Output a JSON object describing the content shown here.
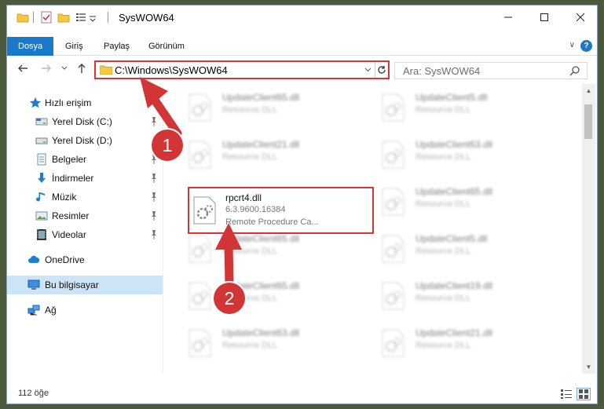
{
  "window": {
    "title": "SysWOW64"
  },
  "ribbon": {
    "tabs": [
      {
        "label": "Dosya",
        "active": true
      },
      {
        "label": "Giriş"
      },
      {
        "label": "Paylaş"
      },
      {
        "label": "Görünüm"
      }
    ],
    "help": "?"
  },
  "navbar": {
    "address": "C:\\Windows\\SysWOW64",
    "search_placeholder": "Ara: SysWOW64"
  },
  "sidebar": {
    "items": [
      {
        "label": "Hızlı erişim",
        "icon": "star-icon"
      },
      {
        "label": "Yerel Disk (C:)",
        "icon": "drive-icon",
        "pinned": true
      },
      {
        "label": "Yerel Disk (D:)",
        "icon": "drive-icon",
        "pinned": true
      },
      {
        "label": "Belgeler",
        "icon": "documents-icon",
        "pinned": true
      },
      {
        "label": "İndirmeler",
        "icon": "download-icon",
        "pinned": true
      },
      {
        "label": "Müzik",
        "icon": "music-icon",
        "pinned": true
      },
      {
        "label": "Resimler",
        "icon": "pictures-icon",
        "pinned": true
      },
      {
        "label": "Videolar",
        "icon": "videos-icon",
        "pinned": true
      },
      {
        "label": "OneDrive",
        "icon": "cloud-icon"
      },
      {
        "label": "Bu bilgisayar",
        "icon": "computer-icon",
        "selected": true
      },
      {
        "label": "Ağ",
        "icon": "network-icon"
      }
    ]
  },
  "files": {
    "left": [
      {
        "name": "UpdateClient65.dll",
        "sub": "Resource DLL"
      },
      {
        "name": "UpdateClient21.dll",
        "sub": "Resource DLL"
      },
      {
        "name": "rpcrt4.dll",
        "sub": "6.3.9600.16384",
        "sub2": "Remote Procedure Ca...",
        "highlight": true
      },
      {
        "name": "UpdateClient65.dll",
        "sub": "Resource DLL"
      },
      {
        "name": "UpdateClient65.dll",
        "sub": "Resource DLL"
      },
      {
        "name": "UpdateClient63.dll",
        "sub": "Resource DLL"
      }
    ],
    "right": [
      {
        "name": "UpdateClient5.dll",
        "sub": "Resource DLL"
      },
      {
        "name": "UpdateClient63.dll",
        "sub": "Resource DLL"
      },
      {
        "name": "UpdateClient65.dll",
        "sub": "Resource DLL"
      },
      {
        "name": "UpdateClient5.dll",
        "sub": "Resource DLL"
      },
      {
        "name": "UpdateClient19.dll",
        "sub": "Resource DLL"
      },
      {
        "name": "UpdateClient21.dll",
        "sub": "Resource DLL"
      }
    ]
  },
  "status": {
    "count": "112 öğe"
  },
  "annotations": {
    "step1": "1",
    "step2": "2",
    "color": "#d23535"
  }
}
